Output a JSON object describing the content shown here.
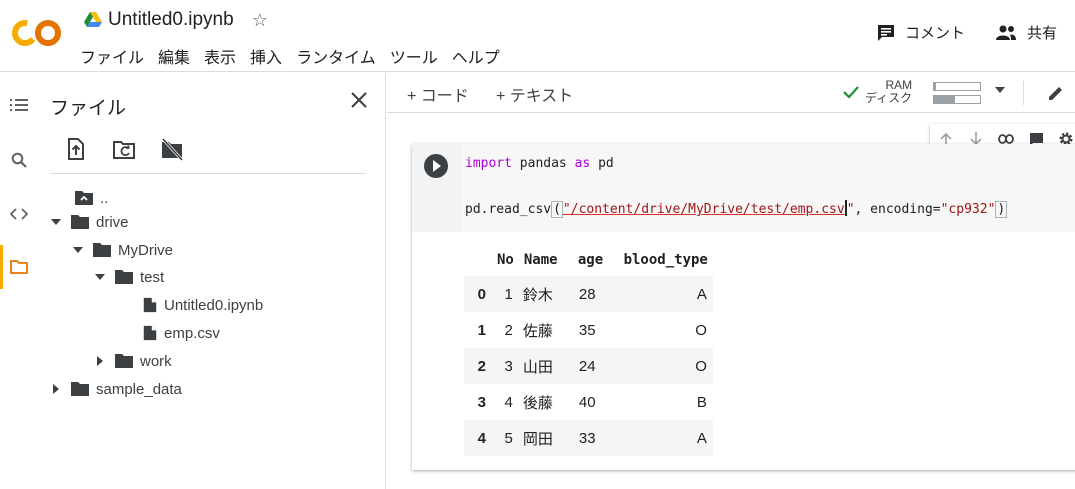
{
  "header": {
    "logo_text": "CO",
    "notebook_title": "Untitled0.ipynb",
    "menu": [
      "ファイル",
      "編集",
      "表示",
      "挿入",
      "ランタイム",
      "ツール",
      "ヘルプ"
    ],
    "comment_label": "コメント",
    "share_label": "共有"
  },
  "rail": {
    "icons": [
      "list-icon",
      "search-icon",
      "code-icon",
      "folder-icon"
    ],
    "active": "folder-icon",
    "accent_color": "#f9ab00"
  },
  "files_panel": {
    "title": "ファイル",
    "tree": [
      {
        "label": "..",
        "type": "parent-folder",
        "depth": 0
      },
      {
        "label": "drive",
        "type": "folder",
        "expanded": true,
        "depth": 0
      },
      {
        "label": "MyDrive",
        "type": "folder",
        "expanded": true,
        "depth": 1
      },
      {
        "label": "test",
        "type": "folder",
        "expanded": true,
        "depth": 2
      },
      {
        "label": "Untitled0.ipynb",
        "type": "file",
        "depth": 3
      },
      {
        "label": "emp.csv",
        "type": "file",
        "depth": 3
      },
      {
        "label": "work",
        "type": "folder",
        "expanded": false,
        "depth": 2
      },
      {
        "label": "sample_data",
        "type": "folder",
        "expanded": false,
        "depth": 0
      }
    ]
  },
  "toolbar": {
    "add_code": "+ コード",
    "add_text": "+ テキスト",
    "ram_label": "RAM",
    "disk_label": "ディスク",
    "ram_usage": 0.05,
    "disk_usage": 0.45,
    "connected_color": "#1e8e3e"
  },
  "cell": {
    "line1": {
      "kw1": "import",
      "t1": " pandas ",
      "kw2": "as",
      "t2": " pd"
    },
    "line2": {
      "t1": "pd.read_csv",
      "p1": "(",
      "s1": "\"/content/drive/MyDrive/test/emp.csv",
      "s1_end": "\"",
      "t2": ", encoding=",
      "s2": "\"cp932\"",
      "p2": ")"
    }
  },
  "output": {
    "columns": [
      "",
      "No",
      "Name",
      "age",
      "blood_type"
    ],
    "rows": [
      {
        "index": "0",
        "No": "1",
        "Name": "鈴木",
        "age": "28",
        "blood_type": "A"
      },
      {
        "index": "1",
        "No": "2",
        "Name": "佐藤",
        "age": "35",
        "blood_type": "O"
      },
      {
        "index": "2",
        "No": "3",
        "Name": "山田",
        "age": "24",
        "blood_type": "O"
      },
      {
        "index": "3",
        "No": "4",
        "Name": "後藤",
        "age": "40",
        "blood_type": "B"
      },
      {
        "index": "4",
        "No": "5",
        "Name": "岡田",
        "age": "33",
        "blood_type": "A"
      }
    ]
  }
}
